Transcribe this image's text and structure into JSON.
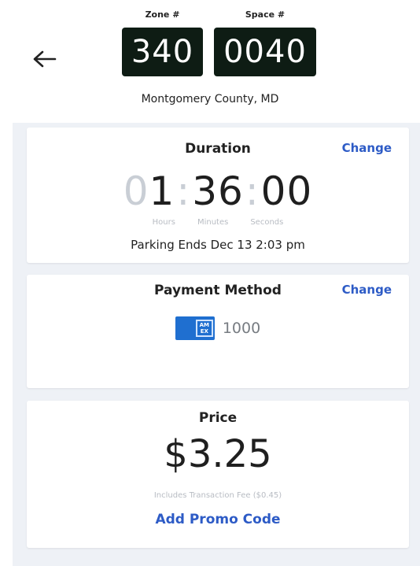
{
  "header": {
    "back_icon": "arrow-left-icon",
    "zone_label": "Zone #",
    "zone_value": "340",
    "space_label": "Space #",
    "space_value": "0040",
    "location": "Montgomery County, MD"
  },
  "duration": {
    "title": "Duration",
    "change_label": "Change",
    "hours_dim": "0",
    "hours": "1",
    "minutes": "36",
    "seconds": "00",
    "unit_hours": "Hours",
    "unit_minutes": "Minutes",
    "unit_seconds": "Seconds",
    "parking_ends": "Parking Ends Dec 13 2:03 pm"
  },
  "payment": {
    "title": "Payment Method",
    "change_label": "Change",
    "card_icon": "amex-card-icon",
    "card_brand_line1": "AM",
    "card_brand_line2": "EX",
    "card_number": "1000"
  },
  "price": {
    "title": "Price",
    "amount": "$3.25",
    "fee_note": "Includes Transaction Fee ($0.45)",
    "promo_label": "Add Promo Code"
  },
  "colors": {
    "accent": "#2d5bc6",
    "plate_bg": "#0e1c14",
    "card_blue": "#1f6fd0",
    "page_bg": "#eef1f6"
  }
}
